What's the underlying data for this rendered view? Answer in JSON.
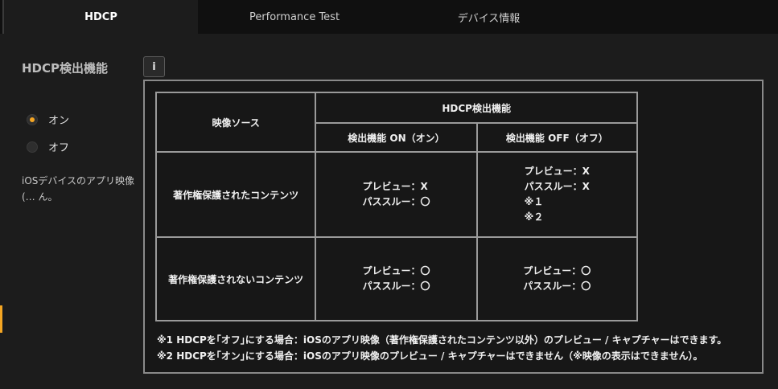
{
  "tabs": [
    {
      "label": "HDCP",
      "active": true
    },
    {
      "label": "Performance Test",
      "active": false
    },
    {
      "label": "デバイス情報",
      "active": false
    }
  ],
  "settings": {
    "section_label": "HDCP検出機能",
    "info_icon_glyph": "i",
    "options": [
      {
        "label": "オン",
        "selected": true
      },
      {
        "label": "オフ",
        "selected": false
      }
    ],
    "description": "iOSデバイスのアプリ映像(… ん。"
  },
  "popup": {
    "table": {
      "col_source_header": "映像ソース",
      "group_header": "HDCP検出機能",
      "col_on_header": "検出機能 ON（オン）",
      "col_off_header": "検出機能 OFF（オフ）",
      "rows": [
        {
          "source": "著作権保護されたコンテンツ",
          "on_lines": [
            "プレビュー：X",
            "パススルー：〇"
          ],
          "off_lines": [
            "プレビュー：X",
            "パススルー：X",
            "※１",
            "※２"
          ]
        },
        {
          "source": "著作権保護されないコンテンツ",
          "on_lines": [
            "プレビュー：〇",
            "パススルー：〇"
          ],
          "off_lines": [
            "プレビュー：〇",
            "パススルー：〇"
          ]
        }
      ]
    },
    "notes": [
      "※1 HDCPを｢オフ｣にする場合：iOSのアプリ映像（著作権保護されたコンテンツ以外）のプレビュー / キャプチャーはできます。",
      "※2 HDCPを｢オン｣にする場合：iOSのアプリ映像のプレビュー / キャプチャーはできません（※映像の表示はできません）。"
    ]
  },
  "colors": {
    "accent": "#f5a623",
    "background": "#1c1c1c",
    "tabbar": "#101010"
  }
}
